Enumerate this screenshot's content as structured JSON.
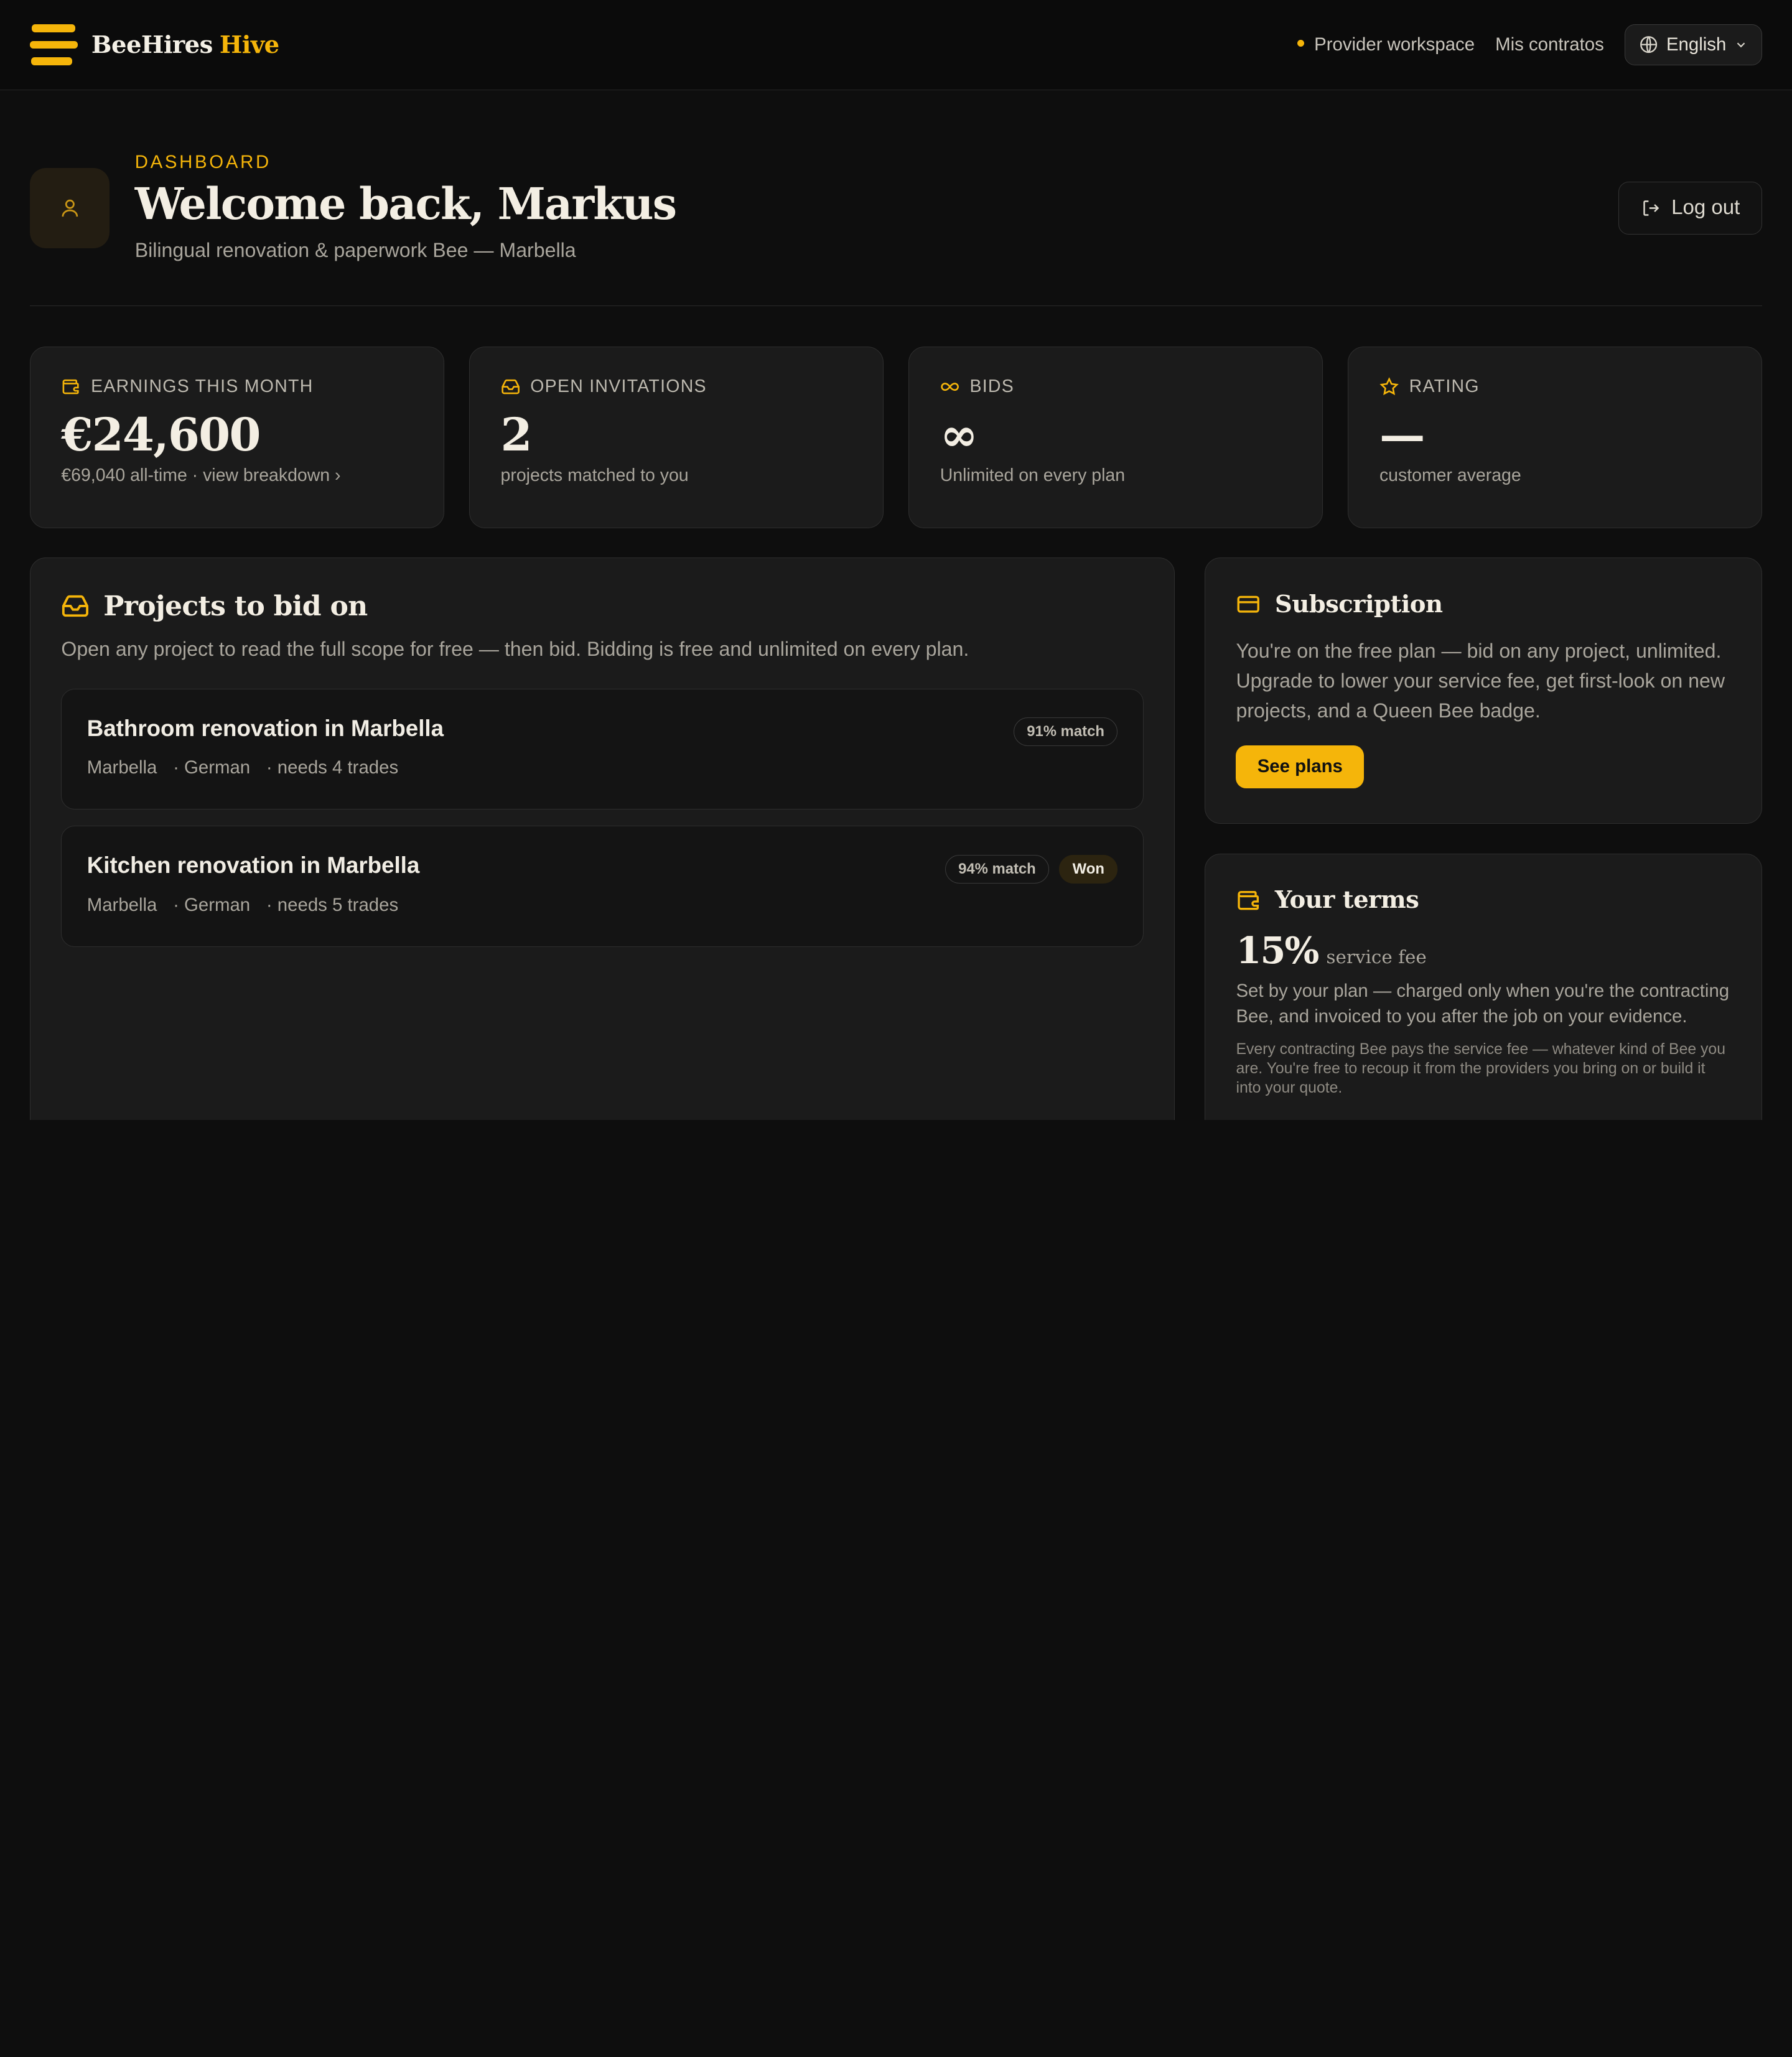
{
  "colors": {
    "accent": "#f5b50a",
    "background": "#0e0e0e",
    "card": "#1b1b1b"
  },
  "header": {
    "brand_main": "BeeHires",
    "brand_accent": "Hive",
    "workspace_label": "Provider workspace",
    "contracts_link": "Mis contratos",
    "language": "English"
  },
  "welcome": {
    "eyebrow": "DASHBOARD",
    "title": "Welcome back, Markus",
    "subtitle": "Bilingual renovation & paperwork Bee — Marbella",
    "logout_label": "Log out"
  },
  "stats": [
    {
      "icon": "wallet-icon",
      "label": "EARNINGS THIS MONTH",
      "value": "€24,600",
      "sub": "€69,040 all-time · view breakdown ›"
    },
    {
      "icon": "inbox-icon",
      "label": "OPEN INVITATIONS",
      "value": "2",
      "sub": "projects matched to you"
    },
    {
      "icon": "infinity-icon",
      "label": "BIDS",
      "value": "∞",
      "sub": "Unlimited on every plan"
    },
    {
      "icon": "star-icon",
      "label": "RATING",
      "value": "—",
      "sub": "customer average"
    }
  ],
  "projects": {
    "title": "Projects to bid on",
    "description": "Open any project to read the full scope for free — then bid. Bidding is free and unlimited on every plan.",
    "items": [
      {
        "title": "Bathroom renovation in Marbella",
        "location": "Marbella",
        "language": "· German",
        "trades": "· needs 4 trades",
        "match": "91% match",
        "status": ""
      },
      {
        "title": "Kitchen renovation in Marbella",
        "location": "Marbella",
        "language": "· German",
        "trades": "· needs 5 trades",
        "match": "94% match",
        "status": "Won"
      }
    ]
  },
  "subscription": {
    "title": "Subscription",
    "text": "You're on the free plan — bid on any project, unlimited. Upgrade to lower your service fee, get first-look on new projects, and a Queen Bee badge.",
    "button": "See plans"
  },
  "terms": {
    "title": "Your terms",
    "fee_value": "15%",
    "fee_label": "service fee",
    "text": "Set by your plan — charged only when you're the contracting Bee, and invoiced to you after the job on your evidence.",
    "small": "Every contracting Bee pays the service fee — whatever kind of Bee you are. You're free to recoup it from the providers you bring on or build it into your quote."
  }
}
